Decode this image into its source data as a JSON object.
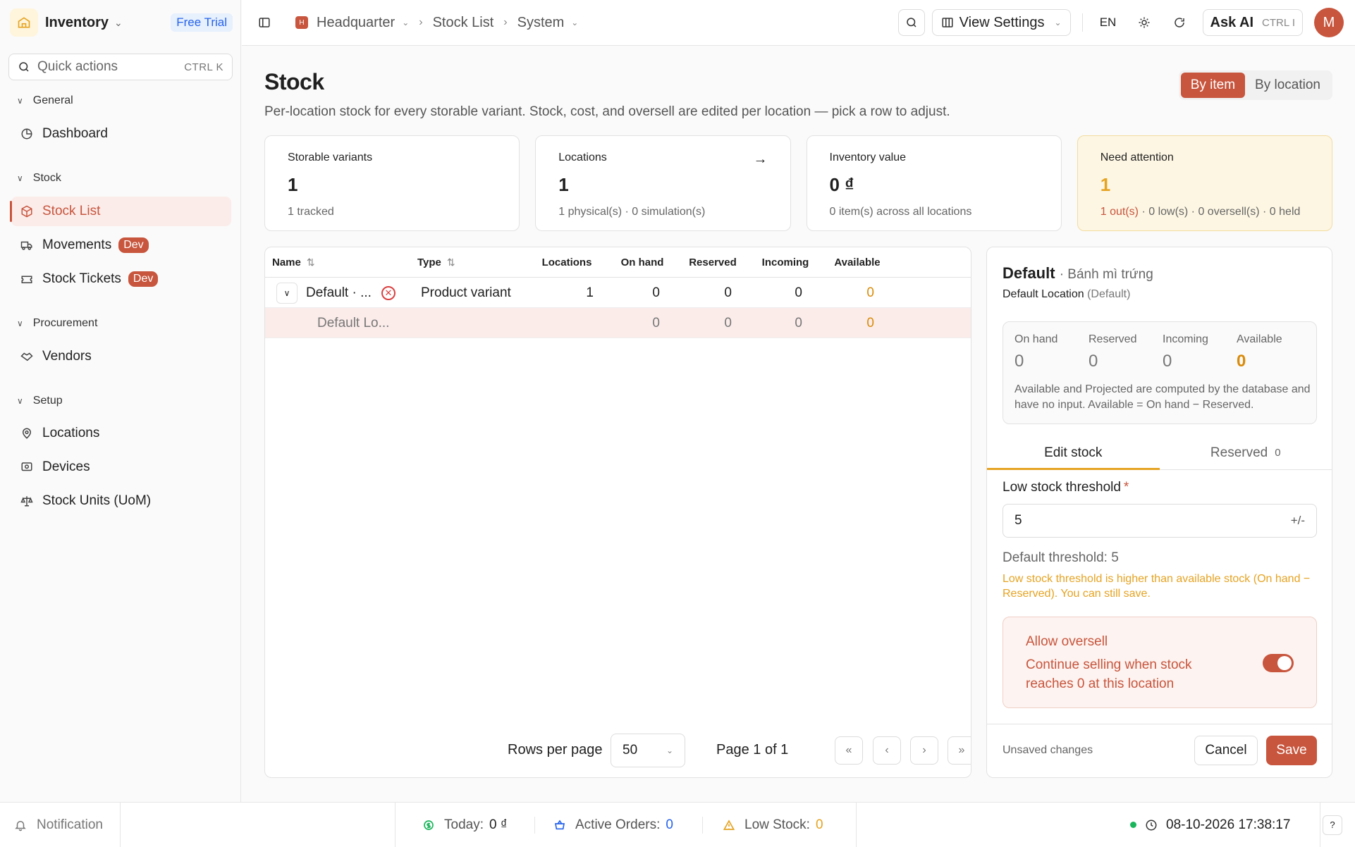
{
  "sidebar": {
    "brand": "Inventory",
    "trial_badge": "Free Trial",
    "quick_actions": {
      "label": "Quick actions",
      "shortcut": "CTRL K"
    },
    "groups": {
      "general": "General",
      "stock": "Stock",
      "procurement": "Procurement",
      "setup": "Setup"
    },
    "items": {
      "dashboard": "Dashboard",
      "stock_list": "Stock List",
      "movements": "Movements",
      "stock_tickets": "Stock Tickets",
      "vendors": "Vendors",
      "locations": "Locations",
      "devices": "Devices",
      "stock_units": "Stock Units (UoM)"
    },
    "dev_badge": "Dev"
  },
  "topbar": {
    "breadcrumb": {
      "org_initial": "H",
      "org": "Headquarter",
      "page": "Stock List",
      "section": "System"
    },
    "view_settings": "View Settings",
    "language": "EN",
    "ask_ai": {
      "label": "Ask AI",
      "shortcut": "CTRL I"
    },
    "avatar_initial": "M"
  },
  "page": {
    "title": "Stock",
    "subtitle": "Per-location stock for every storable variant. Stock, cost, and oversell are edited per location — pick a row to adjust.",
    "view_toggle": {
      "by_item": "By item",
      "by_location": "By location",
      "selected": "by_item"
    }
  },
  "cards": {
    "variants": {
      "label": "Storable variants",
      "value": "1",
      "sub": "1 tracked"
    },
    "locations": {
      "label": "Locations",
      "value": "1",
      "sub": "1 physical(s) · 0 simulation(s)"
    },
    "value": {
      "label": "Inventory value",
      "value": "0 ₫",
      "sub": "0 item(s) across all locations"
    },
    "attention": {
      "label": "Need attention",
      "value": "1",
      "sub_out": "1 out(s)",
      "sub_rest": " · 0 low(s) · 0 oversell(s) · 0 held"
    }
  },
  "table": {
    "columns": {
      "name": "Name",
      "type": "Type",
      "locations": "Locations",
      "on_hand": "On hand",
      "reserved": "Reserved",
      "incoming": "Incoming",
      "available": "Available"
    },
    "rows": [
      {
        "name": "Default · ...",
        "type": "Product variant",
        "locations": "1",
        "on_hand": "0",
        "reserved": "0",
        "incoming": "0",
        "available": "0"
      }
    ],
    "sub_rows": [
      {
        "name": "Default Lo...",
        "on_hand": "0",
        "reserved": "0",
        "incoming": "0",
        "available": "0"
      }
    ],
    "pagination": {
      "rows_per_page_label": "Rows per page",
      "rows_per_page": "50",
      "page_text": "Page 1 of 1"
    }
  },
  "detail": {
    "title": "Default",
    "variant": "· Bánh mì trứng",
    "location": "Default Location",
    "location_note": "(Default)",
    "stats": {
      "on_hand": {
        "label": "On hand",
        "value": "0"
      },
      "reserved": {
        "label": "Reserved",
        "value": "0"
      },
      "incoming": {
        "label": "Incoming",
        "value": "0"
      },
      "available": {
        "label": "Available",
        "value": "0"
      }
    },
    "stats_note": "Available and Projected are computed by the database and have no input. Available = On hand − Reserved.",
    "tabs": {
      "edit": "Edit stock",
      "reserved": "Reserved",
      "reserved_count": "0"
    },
    "threshold": {
      "label": "Low stock threshold",
      "required_mark": "*",
      "value": "5",
      "adjust": "+/-",
      "default_text": "Default threshold: 5",
      "warning": "Low stock threshold is higher than available stock (On hand − Reserved). You can still save."
    },
    "oversell": {
      "title": "Allow oversell",
      "description": "Continue selling when stock reaches 0 at this location",
      "enabled": true
    },
    "footer": {
      "unsaved": "Unsaved changes",
      "cancel": "Cancel",
      "save": "Save"
    }
  },
  "statusbar": {
    "notification": "Notification",
    "today_label": "Today:",
    "today_value": "0 ₫",
    "orders_label": "Active Orders:",
    "orders_value": "0",
    "low_label": "Low Stock:",
    "low_value": "0",
    "datetime": "08-10-2026 17:38:17"
  },
  "colors": {
    "accent": "#c8553d",
    "warning": "#e5a322",
    "available": "#d98b0a",
    "info": "#2563eb",
    "online": "#1bb55c"
  }
}
